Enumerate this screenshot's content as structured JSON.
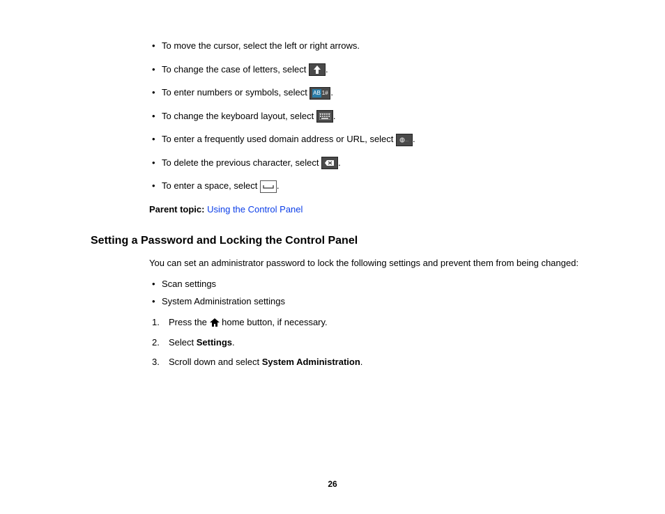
{
  "bullets": [
    {
      "text_before": "To move the cursor, select the left or right arrows.",
      "icon": null,
      "text_after": ""
    },
    {
      "text_before": "To change the case of letters, select ",
      "icon": "shift-up-icon",
      "text_after": "."
    },
    {
      "text_before": "To enter numbers or symbols, select ",
      "icon": "numbers-symbols-icon",
      "text_after": "."
    },
    {
      "text_before": "To change the keyboard layout, select ",
      "icon": "keyboard-layout-icon",
      "text_after": "."
    },
    {
      "text_before": "To enter a frequently used domain address or URL, select ",
      "icon": "domain-url-icon",
      "text_after": "."
    },
    {
      "text_before": "To delete the previous character, select ",
      "icon": "backspace-icon",
      "text_after": "."
    },
    {
      "text_before": "To enter a space, select ",
      "icon": "space-icon",
      "text_after": "."
    }
  ],
  "parent_topic": {
    "label": "Parent topic:",
    "link_text": "Using the Control Panel"
  },
  "section_heading": "Setting a Password and Locking the Control Panel",
  "intro": "You can set an administrator password to lock the following settings and prevent them from being changed:",
  "sub_bullets": [
    "Scan settings",
    "System Administration settings"
  ],
  "steps": [
    {
      "before": "Press the ",
      "icon": "home-icon",
      "after_plain": " home button, if necessary.",
      "bold": null,
      "after_bold": ""
    },
    {
      "before": "Select ",
      "icon": null,
      "after_plain": "",
      "bold": "Settings",
      "after_bold": "."
    },
    {
      "before": "Scroll down and select ",
      "icon": null,
      "after_plain": "",
      "bold": "System Administration",
      "after_bold": "."
    }
  ],
  "page_number": "26"
}
